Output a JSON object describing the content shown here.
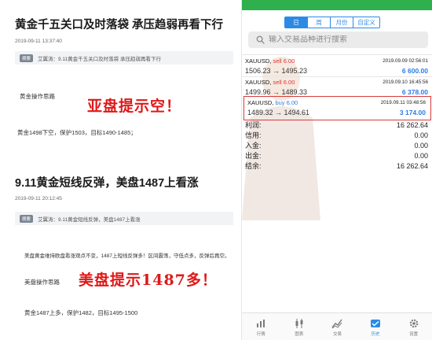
{
  "article1": {
    "title": "黄金千五关口及时落袋 承压趋弱再看下行",
    "date": "2019-09-11 13:37:40",
    "summary_tag": "摘要",
    "summary": "艾翼涛：9.11黄金千五关口及时落袋 承压趋弱再看下行",
    "section": "黄金操作思路",
    "plan": "黄金1498下空，保护1503，目标1490-1485；",
    "note": "亚盘提示空！"
  },
  "article2": {
    "title": "9.11黄金短线反弹，美盘1487上看涨",
    "date": "2019-09-11 20:12:45",
    "summary_tag": "摘要",
    "summary": "艾翼涛：9.11黄金短线反弹，美盘1487上看涨",
    "intro": "美盘黄金维持欧盘看涨观点不变，1487上短线反弹多！区间震荡，守低点多，反弹后再空。",
    "section": "美盘操作思路",
    "plan": "黄金1487上多，保护1482，目标1495-1500",
    "note": "美盘提示1487多！"
  },
  "phone": {
    "tabs": [
      "日",
      "周",
      "月份",
      "自定义"
    ],
    "active_tab": "日",
    "search_placeholder": "输入交易品种进行搜索",
    "trades": [
      {
        "symbol": "XAUUSD,",
        "side": "sell 6.00",
        "time": "2019.09.09 02:56:01",
        "prices": "1506.23 → 1495.23",
        "pnl": "6 600.00"
      },
      {
        "symbol": "XAUUSD,",
        "side": "sell 6.00",
        "time": "2019.09.10 16:45:56",
        "prices": "1499.96 → 1489.33",
        "pnl": "6 378.00"
      },
      {
        "symbol": "XAUUSD,",
        "side": "buy 6.00",
        "time": "2019.09.11 03:48:56",
        "prices": "1489.32 → 1494.61",
        "pnl": "3 174.00"
      }
    ],
    "summary": [
      {
        "label": "利润:",
        "value": "16 262.64"
      },
      {
        "label": "信用:",
        "value": "0.00"
      },
      {
        "label": "入金:",
        "value": "0.00"
      },
      {
        "label": "出金:",
        "value": "0.00"
      },
      {
        "label": "结余:",
        "value": "16 262.64"
      }
    ],
    "nav": [
      {
        "label": "行情",
        "icon": "quotes-icon"
      },
      {
        "label": "图表",
        "icon": "candlestick-chart-icon"
      },
      {
        "label": "交易",
        "icon": "trade-icon"
      },
      {
        "label": "历史",
        "icon": "history-icon"
      },
      {
        "label": "设置",
        "icon": "settings-gear-icon"
      }
    ],
    "active_nav": "历史",
    "colors": {
      "accent": "#2c8ae6",
      "sell": "#e0342f",
      "buy": "#2c7be5",
      "statusbar": "#2fb04d",
      "highlight_border": "#d93a3a"
    }
  }
}
